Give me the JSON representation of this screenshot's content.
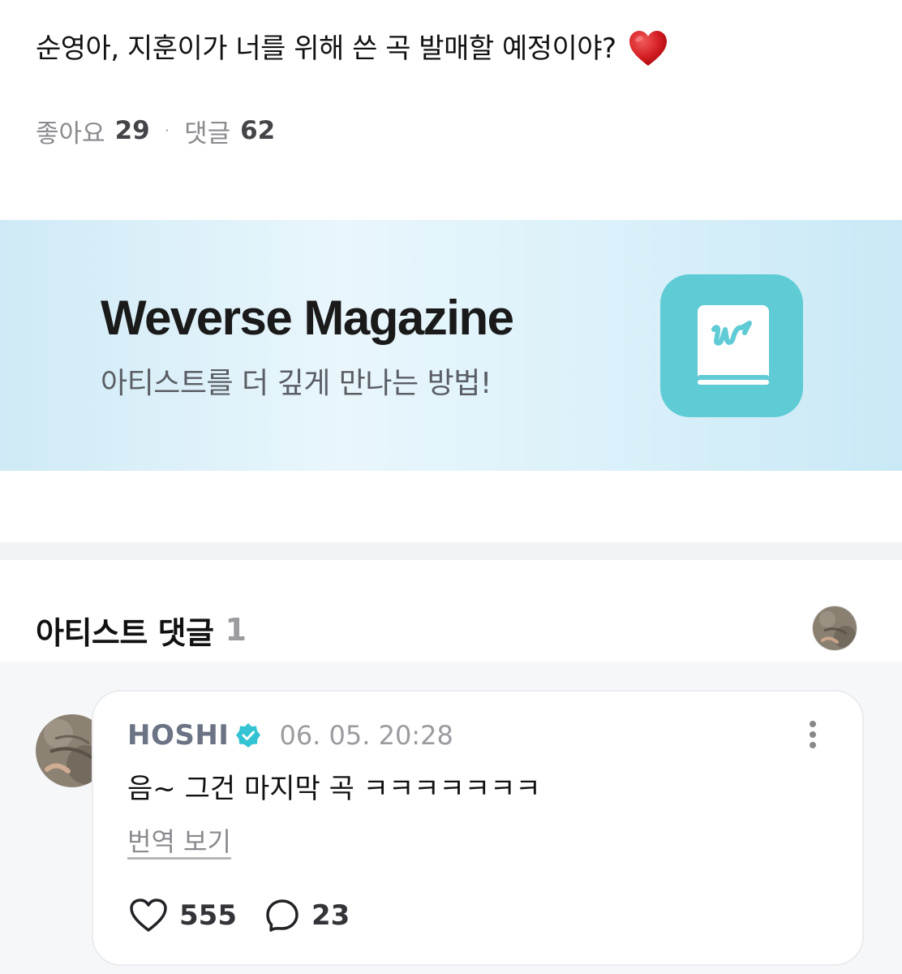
{
  "post": {
    "title": "순영아, 지훈이가 너를 위해 쓴 곡 발매할 예정이야?",
    "emoji": "heart-emoji",
    "likes_label": "좋아요",
    "likes_count": "29",
    "comments_label": "댓글",
    "comments_count": "62",
    "separator": "·"
  },
  "banner": {
    "title": "Weverse Magazine",
    "subtitle": "아티스트를 더 깊게 만나는 방법!",
    "icon": "weverse-magazine-book-icon",
    "icon_color": "#5fcbd4"
  },
  "artist_comments": {
    "heading": "아티스트 댓글",
    "count": "1"
  },
  "comment": {
    "author": "HOSHI",
    "verified_icon": "verified-badge-icon",
    "timestamp": "06. 05. 20:28",
    "text": "음~ 그건 마지막 곡 ㅋㅋㅋㅋㅋㅋㅋ",
    "translate_label": "번역 보기",
    "likes": "555",
    "replies": "23"
  },
  "colors": {
    "verified": "#33c3d3",
    "banner_bg": "#dcf1fa",
    "separator_bg": "#f2f3f5"
  }
}
